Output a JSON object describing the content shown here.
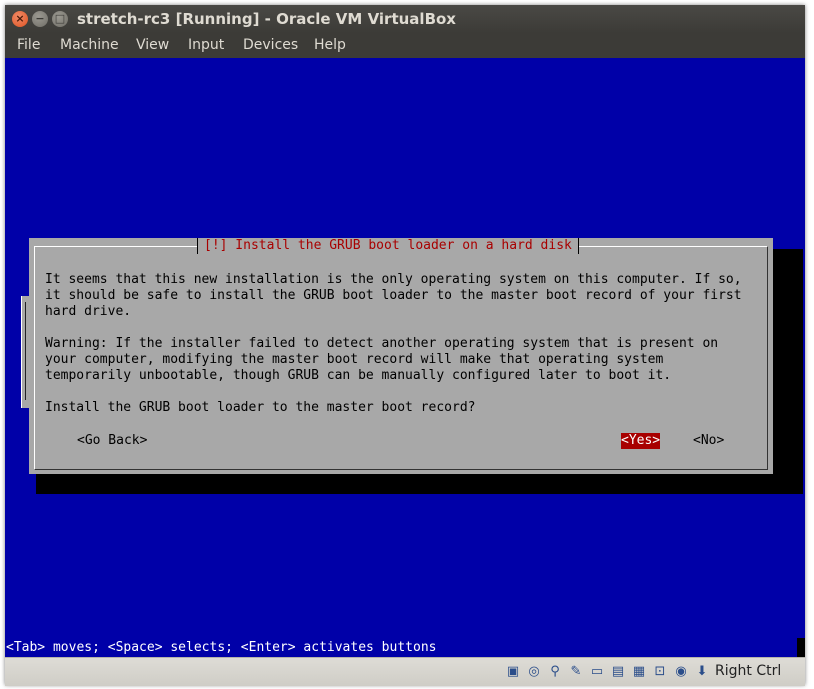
{
  "window": {
    "title": "stretch-rc3 [Running] - Oracle VM VirtualBox",
    "buttons": {
      "close": "×",
      "minimize": "−",
      "maximize": "□"
    }
  },
  "menubar": {
    "items": [
      {
        "label": "File"
      },
      {
        "label": "Machine"
      },
      {
        "label": "View"
      },
      {
        "label": "Input"
      },
      {
        "label": "Devices"
      },
      {
        "label": "Help"
      }
    ]
  },
  "installer": {
    "dialog_title": "[!] Install the GRUB boot loader on a hard disk",
    "paragraph1": [
      "It seems that this new installation is the only operating system on this computer. If so,",
      "it should be safe to install the GRUB boot loader to the master boot record of your first",
      "hard drive."
    ],
    "paragraph2": [
      "Warning: If the installer failed to detect another operating system that is present on",
      "your computer, modifying the master boot record will make that operating system",
      "temporarily unbootable, though GRUB can be manually configured later to boot it."
    ],
    "question": "Install the GRUB boot loader to the master boot record?",
    "buttons": {
      "back": "<Go Back>",
      "yes": "<Yes>",
      "no": "<No>"
    },
    "selected_button": "yes",
    "help_line": "<Tab> moves; <Space> selects; <Enter> activates buttons"
  },
  "statusbar": {
    "icons": [
      "hard-disk-icon",
      "optical-drive-icon",
      "usb-icon",
      "shared-folder-icon",
      "folder-icon",
      "display-icon",
      "screen-icon",
      "network-icon",
      "video-capture-icon",
      "cpu-virtualization-icon",
      "mouse-integration-icon"
    ],
    "host_key": "Right Ctrl"
  },
  "colors": {
    "screen_bg": "#0000a8",
    "dialog_bg": "#a8a8a8",
    "accent_red": "#a80000",
    "titlebar": "#3c3b37"
  }
}
